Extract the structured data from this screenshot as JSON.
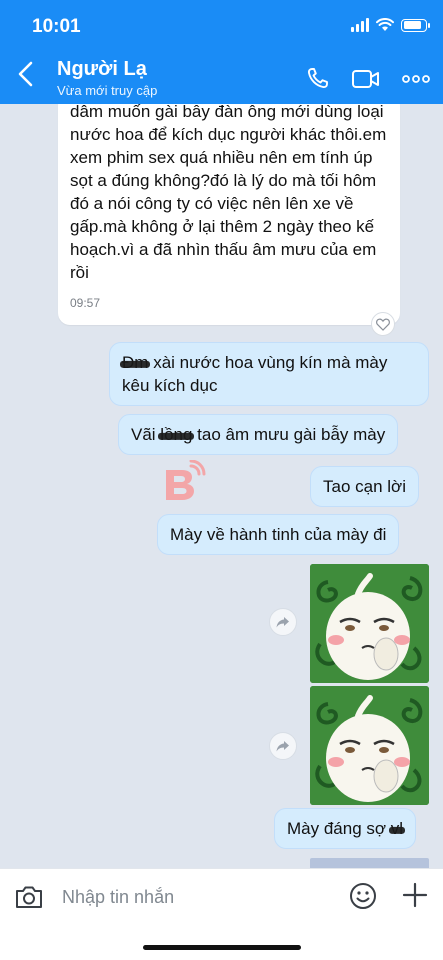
{
  "status_bar": {
    "time": "10:01"
  },
  "header": {
    "name": "Người Lạ",
    "subtitle": "Vừa mới truy cập"
  },
  "messages": {
    "incoming_text": "dâm muốn gài bẫy đàn ông mới dùng loại nước hoa để kích dục người khác thôi.em xem phim sex quá nhiều nên em tính úp sọt a đúng không?đó là lý do mà tối hôm đó a nói công ty có việc nên lên xe về gấp.mà không ở lại thêm 2 ngày theo kế hoạch.vì a đã nhìn thấu âm mưu của em rồi",
    "incoming_time": "09:57",
    "out1_scribbled": "Đm",
    "out1_text": "xài nước hoa vùng kín mà mày kêu kích dục",
    "out2_pre": "Vãi ",
    "out2_scribbled": "lồng",
    "out2_post": " tao âm mưu gài bẫy mày",
    "out3": "Tao cạn lời",
    "out4": "Mày về hành tinh của mày đi",
    "out5_text": "Mày đáng sợ ",
    "out5_scribbled": "vl"
  },
  "input": {
    "placeholder": "Nhập tin nhắn"
  },
  "colors": {
    "header": "#1a8cf6",
    "chat_bg": "#dfe5ee",
    "outgoing": "#d5ecfd",
    "incoming": "#ffffff"
  },
  "icons": [
    "back-icon",
    "phone-icon",
    "video-icon",
    "more-icon",
    "heart-icon",
    "share-icon",
    "camera-icon",
    "emoji-icon",
    "plus-icon"
  ]
}
